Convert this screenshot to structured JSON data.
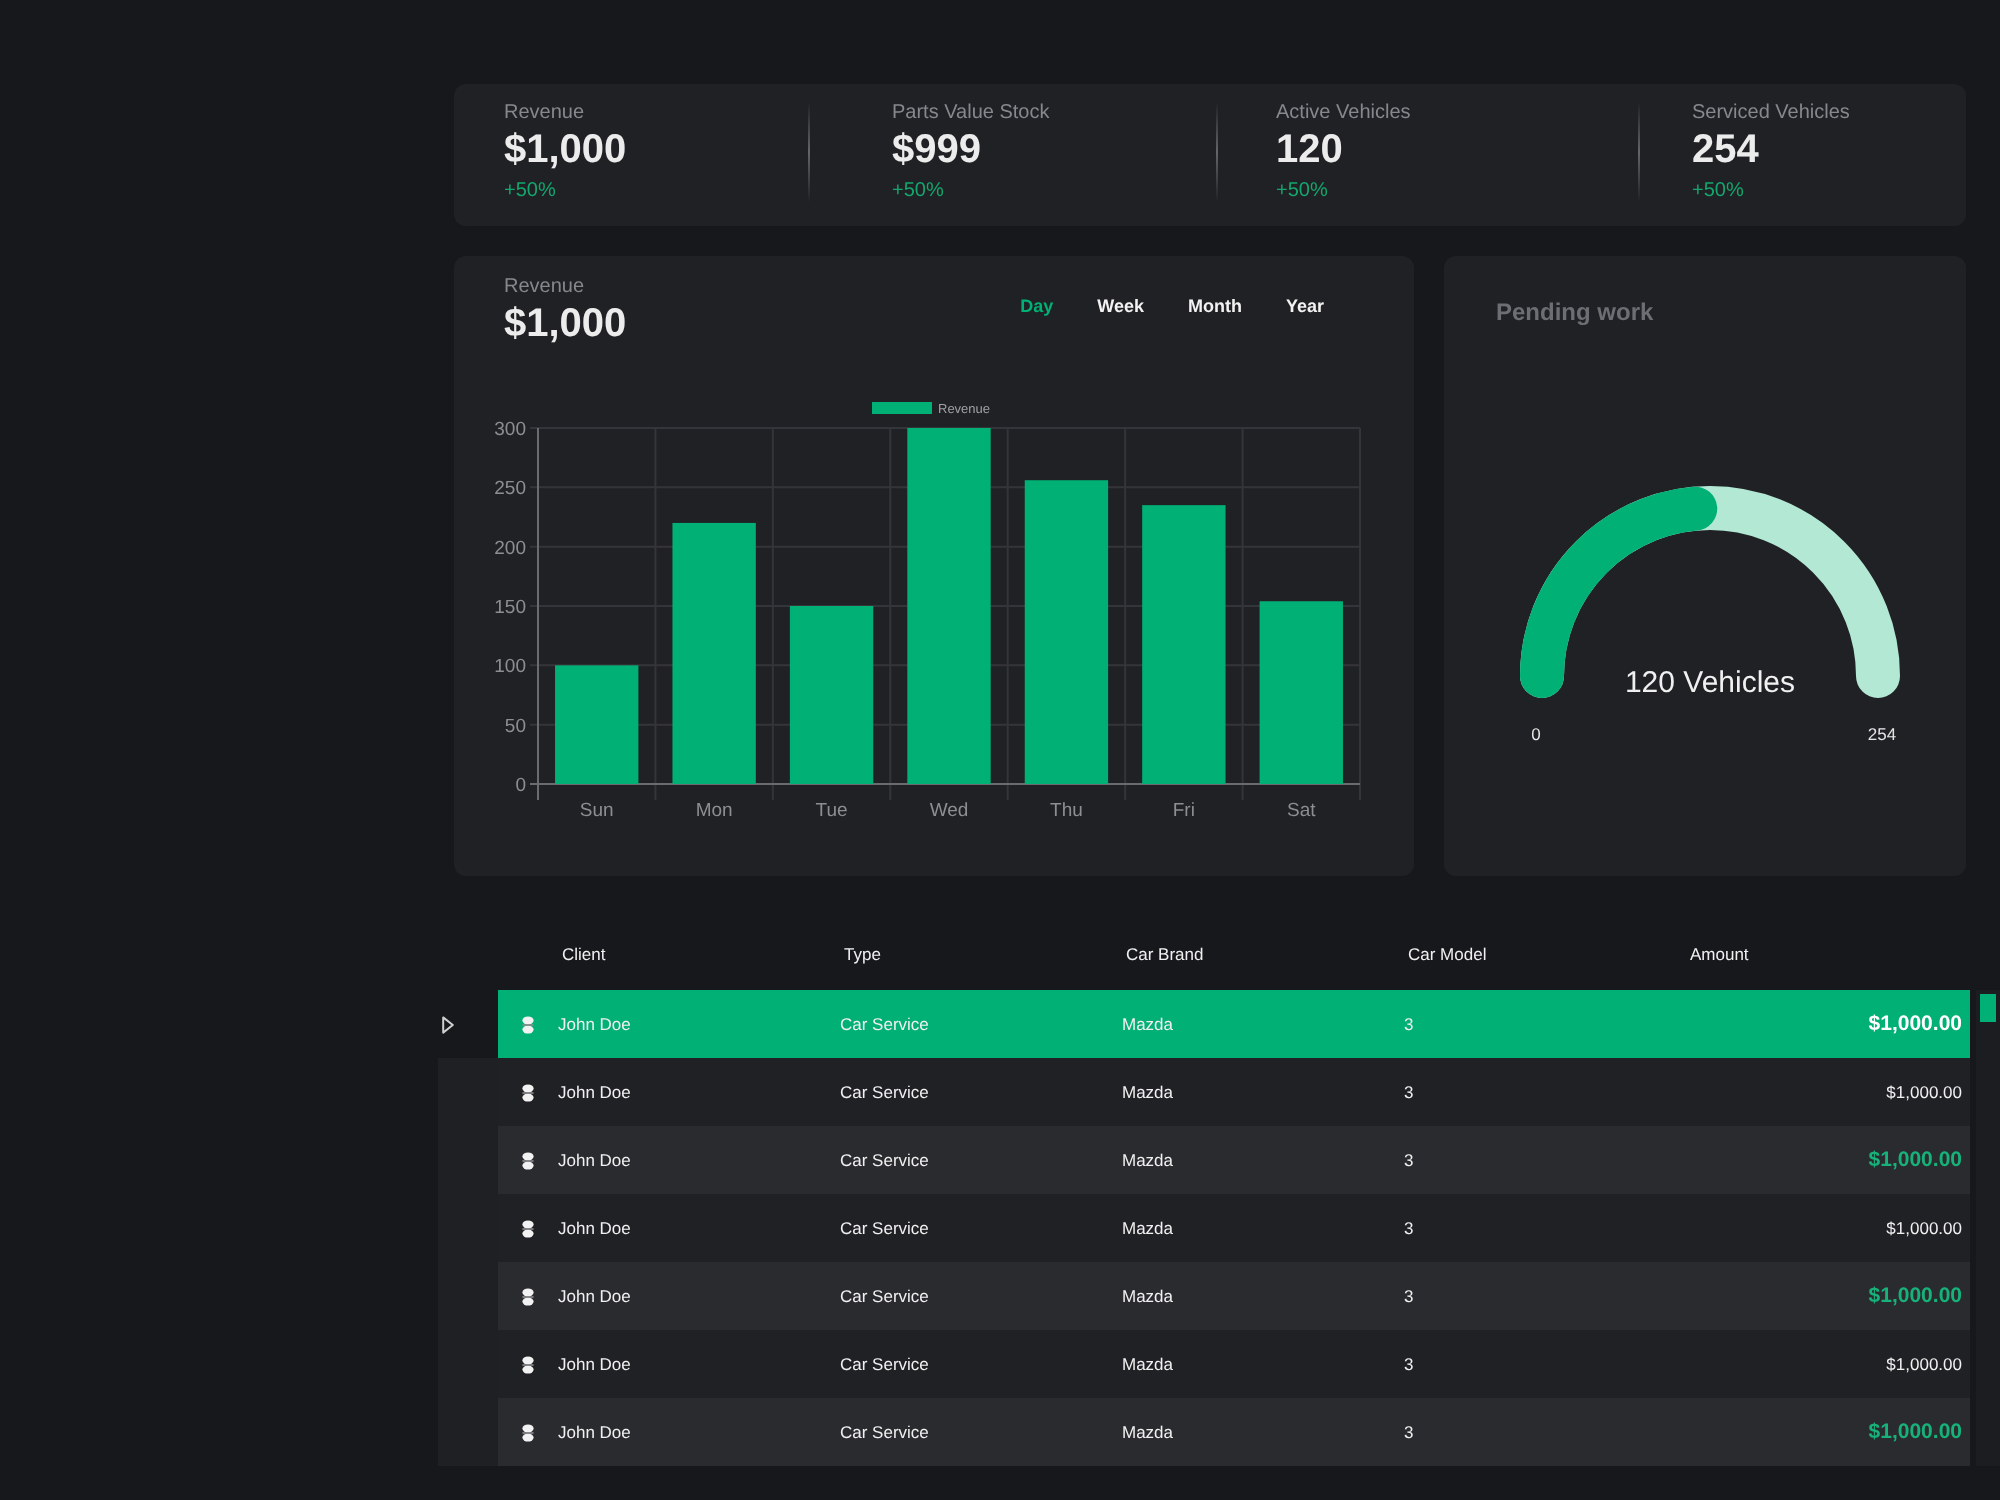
{
  "stats": [
    {
      "label": "Revenue",
      "value": "$1,000",
      "change": "+50%"
    },
    {
      "label": "Parts Value Stock",
      "value": "$999",
      "change": "+50%"
    },
    {
      "label": "Active Vehicles",
      "value": "120",
      "change": "+50%"
    },
    {
      "label": "Serviced Vehicles",
      "value": "254",
      "change": "+50%"
    }
  ],
  "revenue_chart": {
    "label": "Revenue",
    "value": "$1,000",
    "tabs": [
      {
        "label": "Day",
        "selected": true
      },
      {
        "label": "Week",
        "selected": false
      },
      {
        "label": "Month",
        "selected": false
      },
      {
        "label": "Year",
        "selected": false
      }
    ],
    "chart_data": {
      "type": "bar",
      "categories": [
        "Sun",
        "Mon",
        "Tue",
        "Wed",
        "Thu",
        "Fri",
        "Sat"
      ],
      "series": [
        {
          "name": "Revenue",
          "color": "#00b074",
          "values": [
            100,
            220,
            150,
            300,
            256,
            235,
            154
          ]
        }
      ],
      "ylim": [
        0,
        300
      ],
      "yticks": [
        0,
        50,
        100,
        150,
        200,
        250,
        300
      ],
      "grid": true
    }
  },
  "pending_work": {
    "title": "Pending work",
    "value_label": "120 Vehicles",
    "min_label": "0",
    "max_label": "254",
    "level": 0.472
  },
  "table": {
    "columns": [
      "Client",
      "Type",
      "Car Brand",
      "Car Model",
      "Amount"
    ],
    "rows": [
      {
        "client": "John Doe",
        "type": "Car Service",
        "brand": "Mazda",
        "model": "3",
        "amount": "$1,000.00",
        "selected": true,
        "highlighted": false
      },
      {
        "client": "John Doe",
        "type": "Car Service",
        "brand": "Mazda",
        "model": "3",
        "amount": "$1,000.00",
        "selected": false,
        "highlighted": false
      },
      {
        "client": "John Doe",
        "type": "Car Service",
        "brand": "Mazda",
        "model": "3",
        "amount": "$1,000.00",
        "selected": false,
        "highlighted": true
      },
      {
        "client": "John Doe",
        "type": "Car Service",
        "brand": "Mazda",
        "model": "3",
        "amount": "$1,000.00",
        "selected": false,
        "highlighted": false
      },
      {
        "client": "John Doe",
        "type": "Car Service",
        "brand": "Mazda",
        "model": "3",
        "amount": "$1,000.00",
        "selected": false,
        "highlighted": true
      },
      {
        "client": "John Doe",
        "type": "Car Service",
        "brand": "Mazda",
        "model": "3",
        "amount": "$1,000.00",
        "selected": false,
        "highlighted": false
      },
      {
        "client": "John Doe",
        "type": "Car Service",
        "brand": "Mazda",
        "model": "3",
        "amount": "$1,000.00",
        "selected": false,
        "highlighted": true
      }
    ]
  }
}
